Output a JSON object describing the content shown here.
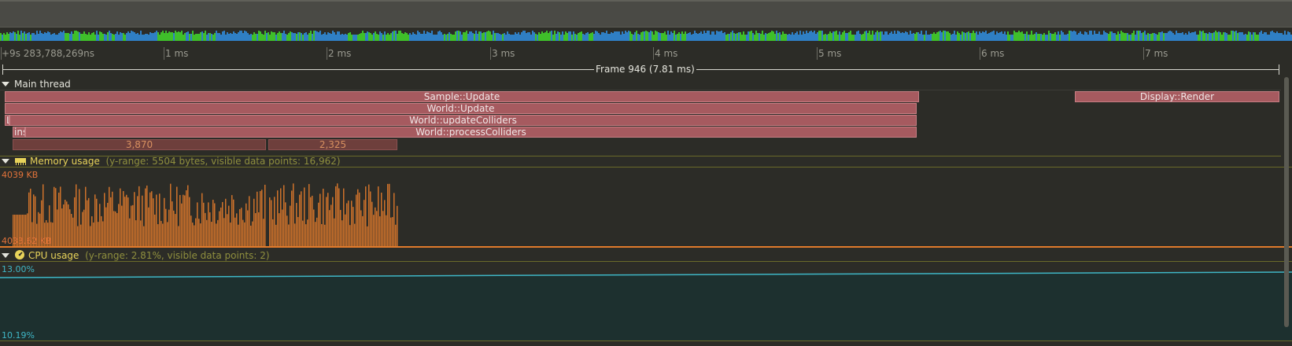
{
  "timeline": {
    "origin_label": "+9s 283,788,269ns",
    "ticks": [
      "1 ms",
      "2 ms",
      "3 ms",
      "4 ms",
      "5 ms",
      "6 ms",
      "7 ms"
    ],
    "frame_label": "Frame 946 (7.81 ms)"
  },
  "main_thread": {
    "title": "Main thread",
    "zones": [
      {
        "label": "Sample::Update"
      },
      {
        "label": "Display::Render"
      },
      {
        "label": "World::Update"
      },
      {
        "label": "L"
      },
      {
        "label": "World::updateColliders"
      },
      {
        "label": "ins"
      },
      {
        "label": "World::processColliders"
      },
      {
        "label": "3,870"
      },
      {
        "label": "2,325"
      }
    ]
  },
  "memory_plot": {
    "title": "Memory usage",
    "meta": "(y-range: 5504 bytes, visible data points: 16,962)",
    "max_label": "4039 KB",
    "min_label": "4033.62 KB",
    "color": "#e07a2c"
  },
  "cpu_plot": {
    "title": "CPU usage",
    "meta": "(y-range: 2.81%, visible data points: 2)",
    "max_label": "13.00%",
    "min_label": "10.19%",
    "color": "#3fb6c6"
  },
  "icons": [
    "expand-triangle-icon",
    "memory-chip-icon",
    "cpu-gauge-icon"
  ]
}
